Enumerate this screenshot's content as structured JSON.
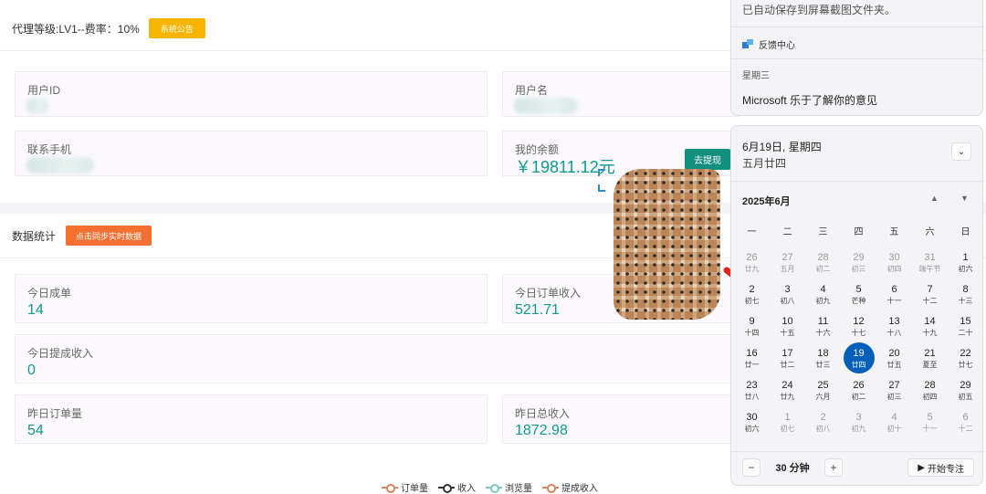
{
  "header": {
    "level_text": "代理等级:LV1--费率：10%",
    "notice_button": "系统公告"
  },
  "profile": {
    "user_id_label": "用户ID",
    "username_label": "用户名",
    "phone_label": "联系手机",
    "balance_label": "我的余额",
    "balance_value": "￥19811.12元",
    "withdraw_button": "去提现"
  },
  "stats": {
    "title": "数据统计",
    "sync_button": "点击同步实时数据",
    "today_orders_label": "今日成单",
    "today_orders_value": "14",
    "today_order_income_label": "今日订单收入",
    "today_order_income_value": "521.71",
    "today_withdraw_income_label": "今日提成收入",
    "today_withdraw_income_value": "0",
    "yesterday_orders_label": "昨日订单量",
    "yesterday_orders_value": "54",
    "yesterday_total_income_label": "昨日总收入",
    "yesterday_total_income_value": "1872.98"
  },
  "legend": [
    {
      "label": "订单量",
      "color": "#e0855a"
    },
    {
      "label": "收入",
      "color": "#333333"
    },
    {
      "label": "浏览量",
      "color": "#7fc7c0"
    },
    {
      "label": "提成收入",
      "color": "#e0855a"
    }
  ],
  "notification": {
    "saved_text": "已自动保存到屏幕截图文件夹。",
    "feedback_label": "反馈中心",
    "weekday": "星期三",
    "message": "Microsoft 乐于了解你的意见"
  },
  "calendar": {
    "date_title": "6月19日, 星期四",
    "lunar_title": "五月廿四",
    "month_label": "2025年6月",
    "weekdays": [
      "一",
      "二",
      "三",
      "四",
      "五",
      "六",
      "日"
    ],
    "weeks": [
      [
        {
          "d": "26",
          "l": "廿九",
          "out": true
        },
        {
          "d": "27",
          "l": "五月",
          "out": true
        },
        {
          "d": "28",
          "l": "初二",
          "out": true
        },
        {
          "d": "29",
          "l": "初三",
          "out": true
        },
        {
          "d": "30",
          "l": "初四",
          "out": true
        },
        {
          "d": "31",
          "l": "端午节",
          "out": true
        },
        {
          "d": "1",
          "l": "初六"
        }
      ],
      [
        {
          "d": "2",
          "l": "初七"
        },
        {
          "d": "3",
          "l": "初八"
        },
        {
          "d": "4",
          "l": "初九"
        },
        {
          "d": "5",
          "l": "芒种"
        },
        {
          "d": "6",
          "l": "十一"
        },
        {
          "d": "7",
          "l": "十二"
        },
        {
          "d": "8",
          "l": "十三"
        }
      ],
      [
        {
          "d": "9",
          "l": "十四"
        },
        {
          "d": "10",
          "l": "十五"
        },
        {
          "d": "11",
          "l": "十六"
        },
        {
          "d": "12",
          "l": "十七"
        },
        {
          "d": "13",
          "l": "十八"
        },
        {
          "d": "14",
          "l": "十九"
        },
        {
          "d": "15",
          "l": "二十"
        }
      ],
      [
        {
          "d": "16",
          "l": "廿一"
        },
        {
          "d": "17",
          "l": "廿二"
        },
        {
          "d": "18",
          "l": "廿三"
        },
        {
          "d": "19",
          "l": "廿四",
          "sel": true
        },
        {
          "d": "20",
          "l": "廿五"
        },
        {
          "d": "21",
          "l": "夏至"
        },
        {
          "d": "22",
          "l": "廿七"
        }
      ],
      [
        {
          "d": "23",
          "l": "廿八"
        },
        {
          "d": "24",
          "l": "廿九"
        },
        {
          "d": "25",
          "l": "六月"
        },
        {
          "d": "26",
          "l": "初二"
        },
        {
          "d": "27",
          "l": "初三"
        },
        {
          "d": "28",
          "l": "初四"
        },
        {
          "d": "29",
          "l": "初五"
        }
      ],
      [
        {
          "d": "30",
          "l": "初六"
        },
        {
          "d": "1",
          "l": "初七",
          "out": true
        },
        {
          "d": "2",
          "l": "初八",
          "out": true
        },
        {
          "d": "3",
          "l": "初九",
          "out": true
        },
        {
          "d": "4",
          "l": "初十",
          "out": true
        },
        {
          "d": "5",
          "l": "十一",
          "out": true
        },
        {
          "d": "6",
          "l": "十二",
          "out": true
        }
      ]
    ],
    "minus": "−",
    "duration": "30 分钟",
    "plus": "+",
    "focus_button": "开始专注"
  }
}
